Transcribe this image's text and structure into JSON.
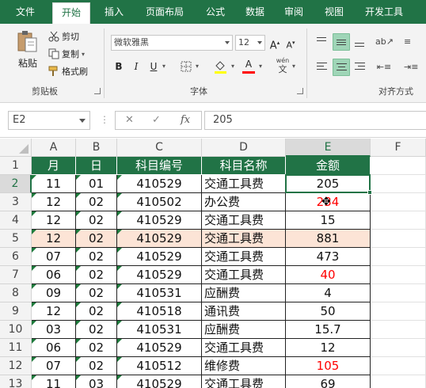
{
  "ribbon_tabs": [
    "文件",
    "开始",
    "插入",
    "页面布局",
    "公式",
    "数据",
    "审阅",
    "视图",
    "开发工具"
  ],
  "active_tab": "开始",
  "clipboard": {
    "paste_label": "粘贴",
    "cut_label": "剪切",
    "copy_label": "复制",
    "format_painter_label": "格式刷",
    "group_label": "剪贴板"
  },
  "font": {
    "font_name": "微软雅黑",
    "font_size": "12",
    "grow_label": "A",
    "shrink_label": "A",
    "bold_label": "B",
    "italic_label": "I",
    "underline_label": "U",
    "font_color_label": "A",
    "phonetic_label": "wén",
    "group_label": "字体"
  },
  "alignment": {
    "group_label": "对齐方式"
  },
  "formula_bar": {
    "name_box": "E2",
    "cancel_symbol": "✕",
    "enter_symbol": "✓",
    "fx_label": "fx",
    "formula": "205"
  },
  "columns": [
    "A",
    "B",
    "C",
    "D",
    "E",
    "F"
  ],
  "row_numbers": [
    "1",
    "2",
    "3",
    "4",
    "5",
    "6",
    "7",
    "8",
    "9",
    "10",
    "11",
    "12",
    "13"
  ],
  "table": {
    "headers": [
      "月",
      "日",
      "科目编号",
      "科目名称",
      "金额"
    ],
    "rows": [
      [
        "11",
        "01",
        "410529",
        "交通工具费",
        "205"
      ],
      [
        "12",
        "02",
        "410502",
        "办公费",
        "234"
      ],
      [
        "12",
        "02",
        "410529",
        "交通工具费",
        "15"
      ],
      [
        "12",
        "02",
        "410529",
        "交通工具费",
        "881"
      ],
      [
        "07",
        "02",
        "410529",
        "交通工具费",
        "473"
      ],
      [
        "06",
        "02",
        "410529",
        "交通工具费",
        "40"
      ],
      [
        "09",
        "02",
        "410531",
        "应酬费",
        "4"
      ],
      [
        "12",
        "02",
        "410518",
        "通讯费",
        "50"
      ],
      [
        "03",
        "02",
        "410531",
        "应酬费",
        "15.7"
      ],
      [
        "06",
        "02",
        "410529",
        "交通工具费",
        "12"
      ],
      [
        "07",
        "02",
        "410512",
        "维修费",
        "105"
      ],
      [
        "11",
        "03",
        "410529",
        "交通工具费",
        "69"
      ]
    ],
    "red_amount_rows": [
      1,
      5,
      10
    ],
    "highlighted_row": 3
  },
  "colors": {
    "excel_green": "#217346",
    "highlight_row": "#fce4d6",
    "negative_red": "#ff0000"
  },
  "icons": [
    "paste-icon",
    "cut-icon",
    "copy-icon",
    "format-painter-icon",
    "border-icon",
    "fill-color-icon",
    "font-color-icon",
    "move-cursor-icon"
  ]
}
